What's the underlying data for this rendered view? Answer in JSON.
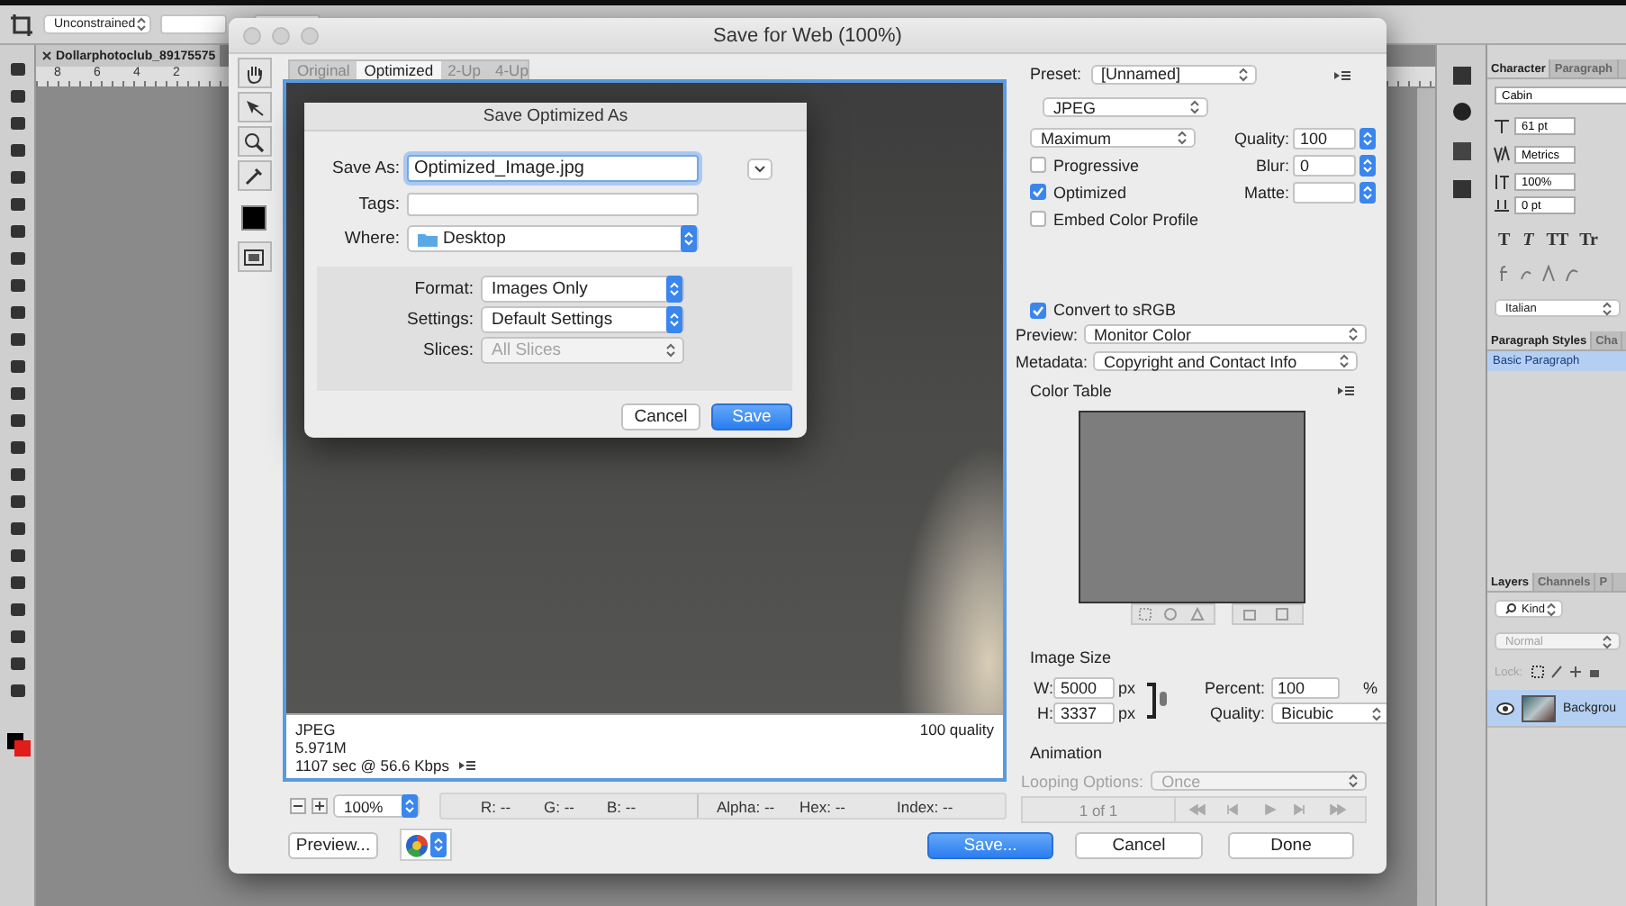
{
  "options_bar": {
    "constraint": "Unconstrained"
  },
  "document": {
    "tab": "Dollarphotoclub_89175575",
    "ruler_labels": [
      "8",
      "6",
      "4",
      "2"
    ]
  },
  "save_for_web": {
    "title": "Save for Web (100%)",
    "view_tabs": [
      {
        "label": "Original",
        "selected": false
      },
      {
        "label": "Optimized",
        "selected": true
      },
      {
        "label": "2-Up",
        "selected": false
      },
      {
        "label": "4-Up",
        "selected": false
      }
    ],
    "preview_info": {
      "format": "JPEG",
      "size": "5.971M",
      "time": "1107 sec @ 56.6 Kbps",
      "quality": "100 quality"
    },
    "zoom": "100%",
    "readouts": [
      "R: --",
      "G: --",
      "B: --",
      "Alpha: --",
      "Hex: --",
      "Index: --"
    ],
    "buttons": {
      "preview": "Preview...",
      "save": "Save...",
      "cancel": "Cancel",
      "done": "Done"
    },
    "settings": {
      "preset": {
        "label": "Preset:",
        "value": "[Unnamed]"
      },
      "format": "JPEG",
      "compression": "Maximum",
      "right_fields": [
        {
          "label": "Quality:",
          "value": "100"
        },
        {
          "label": "Blur:",
          "value": "0"
        },
        {
          "label": "Matte:"
        }
      ],
      "checkboxes": [
        {
          "label": "Progressive",
          "checked": false
        },
        {
          "label": "Optimized",
          "checked": true
        },
        {
          "label": "Embed Color Profile",
          "checked": false
        }
      ],
      "convert_srgb": {
        "label": "Convert to sRGB",
        "checked": true
      },
      "preview": {
        "label": "Preview:",
        "value": "Monitor Color"
      },
      "metadata": {
        "label": "Metadata:",
        "value": "Copyright and Contact Info"
      },
      "color_table": {
        "title": "Color Table"
      },
      "image_size": {
        "title": "Image Size",
        "width": {
          "label": "W:",
          "value": "5000",
          "unit": "px"
        },
        "height": {
          "label": "H:",
          "value": "3337",
          "unit": "px"
        },
        "percent": {
          "label": "Percent:",
          "value": "100",
          "unit": "%"
        },
        "quality": {
          "label": "Quality:",
          "value": "Bicubic"
        }
      },
      "animation": {
        "title": "Animation",
        "looping": {
          "label": "Looping Options:",
          "value": "Once",
          "disabled": true
        },
        "frame": "1 of 1"
      }
    }
  },
  "save_sheet": {
    "title": "Save Optimized As",
    "save_as": {
      "label": "Save As:",
      "value": "Optimized_Image.jpg"
    },
    "tags": {
      "label": "Tags:"
    },
    "where": {
      "label": "Where:",
      "value": "Desktop"
    },
    "options": [
      {
        "label": "Format:",
        "value": "Images Only",
        "disabled": false
      },
      {
        "label": "Settings:",
        "value": "Default Settings",
        "disabled": false
      },
      {
        "label": "Slices:",
        "value": "All Slices",
        "disabled": true
      }
    ],
    "buttons": {
      "cancel": "Cancel",
      "save": "Save"
    }
  },
  "dock": {
    "character": {
      "tabs": [
        {
          "label": "Character",
          "selected": true
        },
        {
          "label": "Paragraph",
          "selected": false
        }
      ],
      "font": "Cabin",
      "size": "61 pt",
      "kerning": "Metrics",
      "scale": "100%",
      "baseline": "0 pt",
      "style_buttons": [
        {
          "label": "T",
          "kind": "bold"
        },
        {
          "label": "T",
          "kind": "italic"
        },
        {
          "label": "TT",
          "kind": "caps"
        },
        {
          "label": "Tr",
          "kind": "smallcaps"
        }
      ],
      "language": "Italian"
    },
    "paragraph_styles": {
      "tabs": [
        {
          "label": "Paragraph Styles",
          "selected": true
        },
        {
          "label": "Cha",
          "selected": false
        }
      ],
      "items": [
        {
          "label": "Basic Paragraph",
          "selected": true
        }
      ]
    },
    "layers": {
      "tabs": [
        {
          "label": "Layers",
          "selected": true
        },
        {
          "label": "Channels",
          "selected": false
        },
        {
          "label": "P",
          "selected": false
        }
      ],
      "filter": "Kind",
      "blend": "Normal",
      "lock_label": "Lock:",
      "items": [
        {
          "name": "Backgrou",
          "selected": true,
          "visible": true
        }
      ]
    }
  }
}
